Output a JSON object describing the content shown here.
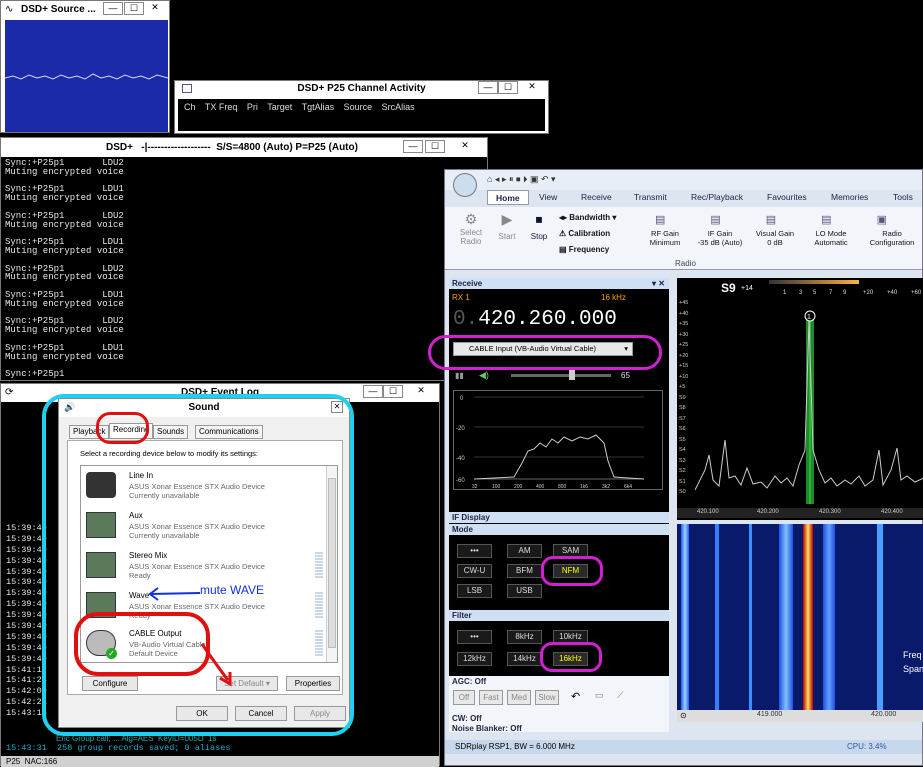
{
  "source_win": {
    "title": "DSD+ Source ..."
  },
  "channel_win": {
    "title": "DSD+ P25 Channel Activity",
    "cols": [
      "Ch",
      "TX Freq",
      "Pri",
      "Target",
      "TgtAlias",
      "Source",
      "SrcAlias"
    ]
  },
  "dsd_win": {
    "title": "DSD+   -|-------------------  S/S=4800 (Auto) P=P25 (Auto)",
    "lines": [
      "Sync:+P25p1       LDU2",
      "Muting encrypted voice",
      "",
      "Sync:+P25p1       LDU1",
      "Muting encrypted voice",
      "",
      "Sync:+P25p1       LDU2",
      "Muting encrypted voice",
      "",
      "Sync:+P25p1       LDU1",
      "Muting encrypted voice",
      "",
      "Sync:+P25p1       LDU2",
      "Muting encrypted voice",
      "",
      "Sync:+P25p1       LDU1",
      "Muting encrypted voice",
      "",
      "Sync:+P25p1       LDU2",
      "Muting encrypted voice",
      "",
      "Sync:+P25p1       LDU1",
      "Muting encrypted voice",
      "",
      "Sync:+P25p1"
    ]
  },
  "event_log": {
    "title": "DSD+ Event Log",
    "times": [
      "15:39:49",
      "15:39:49",
      "15:39:49",
      "15:39:49",
      "15:39:49",
      "15:39:49",
      "15:39:49",
      "15:39:49",
      "15:39:49",
      "15:39:49",
      "15:39:49",
      "15:39:49",
      "15:39:49",
      "15:41:17",
      "15:41:24",
      "15:42:09",
      "15:42:21",
      "15:43:15"
    ],
    "last_line": "15:43:31  258 group records saved; 0 aliases",
    "status": "P25  NAC:166",
    "enc_fragment": "Enc Group call; ... Alg=AES  KeyID=005D  1s"
  },
  "sound": {
    "title": "Sound",
    "tabs": [
      "Playback",
      "Recording",
      "Sounds",
      "Communications"
    ],
    "instruction": "Select a recording device below to modify its settings:",
    "devices": [
      {
        "name": "Line In",
        "desc": "ASUS Xonar Essence STX Audio Device",
        "state": "Currently unavailable"
      },
      {
        "name": "Aux",
        "desc": "ASUS Xonar Essence STX Audio Device",
        "state": "Currently unavailable"
      },
      {
        "name": "Stereo Mix",
        "desc": "ASUS Xonar Essence STX Audio Device",
        "state": "Ready"
      },
      {
        "name": "Wave",
        "desc": "ASUS Xonar Essence STX Audio Device",
        "state": "Ready"
      },
      {
        "name": "CABLE Output",
        "desc": "VB-Audio Virtual Cable",
        "state": "Default Device"
      }
    ],
    "configure": "Configure",
    "set_default": "Set Default",
    "properties": "Properties",
    "ok": "OK",
    "cancel": "Cancel",
    "apply": "Apply",
    "annotation": "mute WAVE"
  },
  "sdr": {
    "ribbon_tabs": [
      "Home",
      "View",
      "Receive",
      "Transmit",
      "Rec/Playback",
      "Favourites",
      "Memories",
      "Tools"
    ],
    "ribbon_items": [
      {
        "label": "Select Radio",
        "sub": ""
      },
      {
        "label": "Start",
        "sub": ""
      },
      {
        "label": "Stop",
        "sub": ""
      }
    ],
    "bandwidth": "Bandwidth",
    "calibration": "Calibration",
    "frequency": "Frequency",
    "rf_gain": {
      "label": "RF Gain",
      "value": "Minimum"
    },
    "if_gain": {
      "label": "IF Gain",
      "value": "-35 dB (Auto)"
    },
    "visual_gain": {
      "label": "Visual Gain",
      "value": "0 dB"
    },
    "lo_mode": {
      "label": "LO Mode",
      "value": "Automatic"
    },
    "radio_cfg": {
      "label": "Radio",
      "value": "Configuration"
    },
    "group_label": "Radio",
    "receive": {
      "title": "Receive",
      "rx": "RX 1",
      "bw": "16 kHz",
      "freq": "420.260.000",
      "freq_prefix": "0.",
      "audio_device": "CABLE Input (VB-Audio Virtual Cable)",
      "volume": "65",
      "spec_x": [
        "32",
        "100",
        "200",
        "400",
        "800",
        "1k6",
        "3k2",
        "6k4"
      ],
      "spec_y": [
        "0",
        "-20",
        "-40",
        "-60"
      ]
    },
    "if_display": "IF Display",
    "mode": {
      "title": "Mode",
      "buttons": [
        "•••",
        "AM",
        "SAM",
        "CW-U",
        "BFM",
        "NFM",
        "LSB",
        "USB"
      ],
      "selected": "NFM"
    },
    "filter": {
      "title": "Filter",
      "buttons": [
        "•••",
        "8kHz",
        "10kHz",
        "12kHz",
        "14kHz",
        "16kHz"
      ],
      "selected": "16kHz"
    },
    "agc": {
      "title": "AGC: Off",
      "buttons": [
        "Off",
        "Fast",
        "Med",
        "Slow"
      ]
    },
    "cw": "CW: Off",
    "noise_blanker": "Noise Blanker: Off",
    "smeter": {
      "reading": "S9",
      "plus": "+14",
      "scale": [
        "1",
        "3",
        "5",
        "7",
        "9",
        "+20",
        "+40",
        "+60"
      ]
    },
    "spectrum": {
      "ylabels": [
        "+45",
        "+40",
        "+35",
        "+30",
        "+25",
        "+20",
        "+15",
        "+10",
        "+5",
        "S9",
        "S8",
        "S7",
        "S6",
        "S5",
        "S4",
        "S3",
        "S2",
        "S1",
        "S0"
      ],
      "xlabels": [
        "420.100",
        "420.200",
        "420.300",
        "420.400"
      ],
      "marker": "1"
    },
    "waterfall": {
      "xlabels": [
        "419.000",
        "420.000"
      ],
      "side_text": [
        "Freq",
        "Span"
      ]
    },
    "status": {
      "left": "SDRplay RSP1, BW = 6.000 MHz",
      "cpu": "CPU: 3.4%"
    }
  },
  "colors": {
    "highlight_magenta": "#d020d0",
    "highlight_cyan": "#20d0f0",
    "highlight_red": "#e01010",
    "annotation_blue": "#1030e0"
  }
}
